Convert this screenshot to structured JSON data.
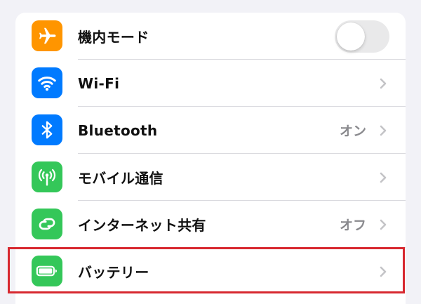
{
  "settings": {
    "rows": [
      {
        "label": "機内モード",
        "value": "",
        "icon": "airplane-icon",
        "color": "#ff9500",
        "control": "toggle",
        "toggle_on": false
      },
      {
        "label": "Wi-Fi",
        "value": "",
        "icon": "wifi-icon",
        "color": "#007aff",
        "control": "chevron"
      },
      {
        "label": "Bluetooth",
        "value": "オン",
        "icon": "bluetooth-icon",
        "color": "#007aff",
        "control": "chevron"
      },
      {
        "label": "モバイル通信",
        "value": "",
        "icon": "antenna-icon",
        "color": "#34c759",
        "control": "chevron"
      },
      {
        "label": "インターネット共有",
        "value": "オフ",
        "icon": "personal-hotspot-icon",
        "color": "#34c759",
        "control": "chevron"
      },
      {
        "label": "バッテリー",
        "value": "",
        "icon": "battery-icon",
        "color": "#34c759",
        "control": "chevron",
        "highlighted": true
      }
    ]
  },
  "colors": {
    "background": "#f2f2f7",
    "highlight": "#d7282f",
    "chevron": "#c4c4c7",
    "secondary_text": "#8a8a8e"
  }
}
